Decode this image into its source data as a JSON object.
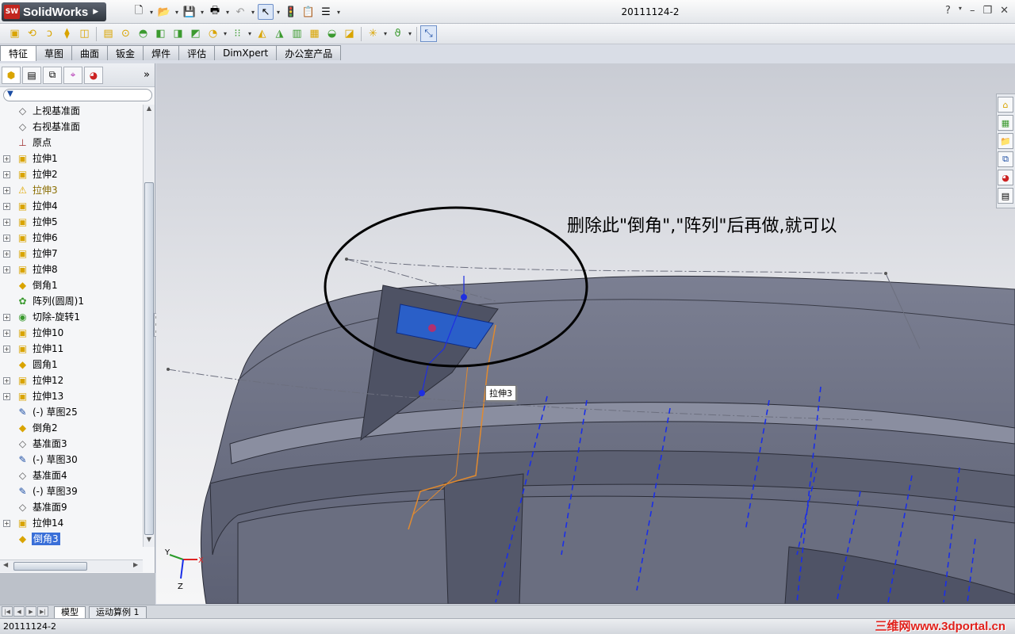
{
  "app": {
    "name": "SolidWorks",
    "logo": "SW",
    "document_title": "20111124-2"
  },
  "title_controls": {
    "help": "?",
    "minimize": "–",
    "restore": "❐",
    "close": "✕"
  },
  "command_tabs": [
    "特征",
    "草图",
    "曲面",
    "钣金",
    "焊件",
    "评估",
    "DimXpert",
    "办公室产品"
  ],
  "active_tab": "特征",
  "tree": [
    {
      "label": "上视基准面",
      "icon": "plane-icon",
      "glyph": "◇",
      "expand": false
    },
    {
      "label": "右视基准面",
      "icon": "plane-icon",
      "glyph": "◇",
      "expand": false
    },
    {
      "label": "原点",
      "icon": "origin-icon",
      "glyph": "⊥",
      "expand": false
    },
    {
      "label": "拉伸1",
      "icon": "boss-extrude-icon",
      "glyph": "▣",
      "expand": true
    },
    {
      "label": "拉伸2",
      "icon": "boss-extrude-icon",
      "glyph": "▣",
      "expand": true
    },
    {
      "label": "拉伸3",
      "icon": "warning-icon",
      "glyph": "⚠",
      "expand": true,
      "warn": true
    },
    {
      "label": "拉伸4",
      "icon": "boss-extrude-icon",
      "glyph": "▣",
      "expand": true
    },
    {
      "label": "拉伸5",
      "icon": "boss-extrude-icon",
      "glyph": "▣",
      "expand": true
    },
    {
      "label": "拉伸6",
      "icon": "cut-extrude-icon",
      "glyph": "▣",
      "expand": true
    },
    {
      "label": "拉伸7",
      "icon": "cut-extrude-icon",
      "glyph": "▣",
      "expand": true
    },
    {
      "label": "拉伸8",
      "icon": "cut-extrude-icon",
      "glyph": "▣",
      "expand": true
    },
    {
      "label": "倒角1",
      "icon": "chamfer-icon",
      "glyph": "◆",
      "expand": false
    },
    {
      "label": "阵列(圆周)1",
      "icon": "circular-pattern-icon",
      "glyph": "✿",
      "expand": false
    },
    {
      "label": "切除-旋转1",
      "icon": "revolve-cut-icon",
      "glyph": "◉",
      "expand": true
    },
    {
      "label": "拉伸10",
      "icon": "boss-extrude-icon",
      "glyph": "▣",
      "expand": true
    },
    {
      "label": "拉伸11",
      "icon": "boss-extrude-icon",
      "glyph": "▣",
      "expand": true
    },
    {
      "label": "圆角1",
      "icon": "fillet-icon",
      "glyph": "◆",
      "expand": false
    },
    {
      "label": "拉伸12",
      "icon": "cut-extrude-icon",
      "glyph": "▣",
      "expand": true
    },
    {
      "label": "拉伸13",
      "icon": "cut-extrude-icon",
      "glyph": "▣",
      "expand": true
    },
    {
      "label": "(-) 草图25",
      "icon": "sketch-icon",
      "glyph": "✎",
      "expand": false
    },
    {
      "label": "倒角2",
      "icon": "chamfer-icon",
      "glyph": "◆",
      "expand": false
    },
    {
      "label": "基准面3",
      "icon": "plane-icon",
      "glyph": "◇",
      "expand": false
    },
    {
      "label": "(-) 草图30",
      "icon": "sketch-icon",
      "glyph": "✎",
      "expand": false
    },
    {
      "label": "基准面4",
      "icon": "plane-icon",
      "glyph": "◇",
      "expand": false
    },
    {
      "label": "(-) 草图39",
      "icon": "sketch-icon",
      "glyph": "✎",
      "expand": false
    },
    {
      "label": "基准面9",
      "icon": "plane-icon",
      "glyph": "◇",
      "expand": false
    },
    {
      "label": "拉伸14",
      "icon": "cut-extrude-icon",
      "glyph": "▣",
      "expand": true
    },
    {
      "label": "倒角3",
      "icon": "chamfer-icon",
      "glyph": "◆",
      "expand": false,
      "selected": true
    }
  ],
  "annotation": "删除此\"倒角\",\"阵列\"后再做,就可以",
  "tooltip": "拉伸3",
  "triad": {
    "x": "X",
    "y": "Y",
    "z": "Z"
  },
  "bottom_tabs": [
    "模型",
    "运动算例 1"
  ],
  "status_text": "20111124-2",
  "watermark": "三维网www.3dportal.cn",
  "colors": {
    "model": "#6f7386",
    "selection": "#2a5fc8",
    "warning": "#e0a800"
  }
}
